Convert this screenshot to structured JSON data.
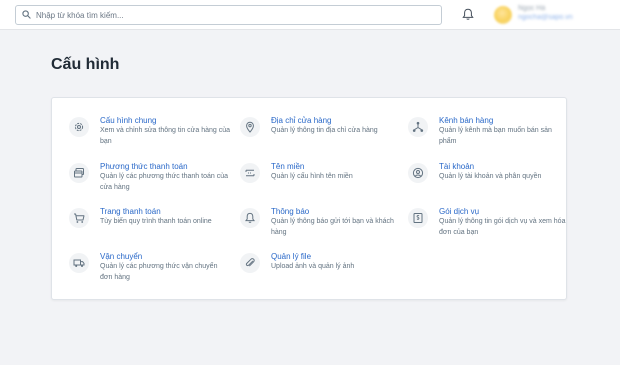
{
  "search": {
    "placeholder": "Nhập từ khóa tìm kiếm..."
  },
  "user": {
    "name": "Ngọc Hà",
    "email": "ngocha@sapo.vn"
  },
  "page": {
    "title": "Cấu hình"
  },
  "settings": [
    {
      "title": "Cấu hình chung",
      "desc": "Xem và chỉnh sửa thông tin cửa hàng của bạn",
      "icon": "gear-icon"
    },
    {
      "title": "Địa chỉ cửa hàng",
      "desc": "Quản lý thông tin địa chỉ cửa hàng",
      "icon": "location-pin-icon"
    },
    {
      "title": "Kênh bán hàng",
      "desc": "Quản lý kênh mà bạn muốn bán sản phẩm",
      "icon": "sales-channel-icon"
    },
    {
      "title": "Phương thức thanh toán",
      "desc": "Quản lý các phương thức thanh toán của cửa hàng",
      "icon": "credit-card-icon"
    },
    {
      "title": "Tên miền",
      "desc": "Quản lý cấu hình tên miền",
      "icon": "domain-icon"
    },
    {
      "title": "Tài khoản",
      "desc": "Quản lý tài khoản và phân quyền",
      "icon": "user-account-icon"
    },
    {
      "title": "Trang thanh toán",
      "desc": "Tùy biến quy trình thanh toán online",
      "icon": "shopping-cart-icon"
    },
    {
      "title": "Thông báo",
      "desc": "Quản lý thông báo gửi tới bạn và khách hàng",
      "icon": "bell-icon"
    },
    {
      "title": "Gói dịch vụ",
      "desc": "Quản lý thông tin gói dịch vụ và xem hóa đơn của bạn",
      "icon": "service-plan-icon"
    },
    {
      "title": "Vận chuyển",
      "desc": "Quản lý các phương thức vận chuyển đơn hàng",
      "icon": "truck-icon"
    },
    {
      "title": "Quản lý file",
      "desc": "Upload ảnh và quản lý ảnh",
      "icon": "paperclip-icon"
    }
  ],
  "colors": {
    "link": "#2968c8",
    "text": "#212b36",
    "muted": "#637381",
    "background": "#f2f3f6"
  }
}
